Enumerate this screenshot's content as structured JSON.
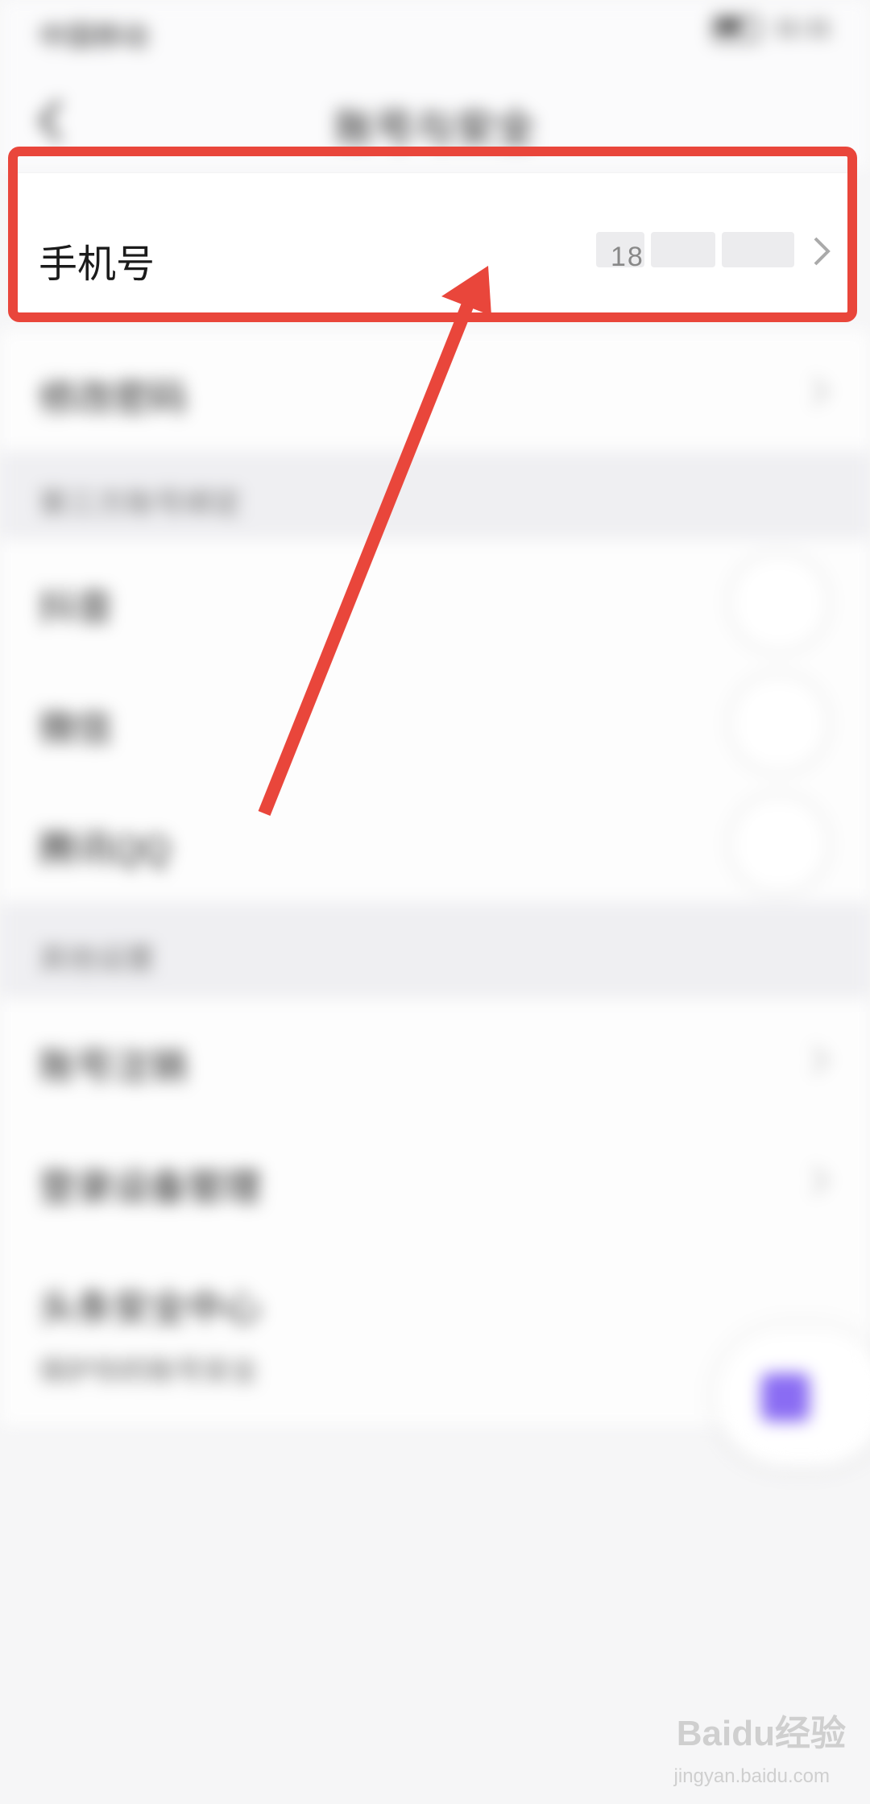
{
  "status_bar": {
    "left": "中国移动",
    "right": "11:11"
  },
  "nav": {
    "title": "账号与安全"
  },
  "phone_row": {
    "label": "手机号",
    "value_prefix": "18"
  },
  "rows_blurred": [
    {
      "label": "修改密码"
    }
  ],
  "section_bind": {
    "label": "第三方账号绑定"
  },
  "bind_items": [
    {
      "label": "抖音"
    },
    {
      "label": "微信"
    },
    {
      "label": "腾讯QQ"
    }
  ],
  "section_other": {
    "label": "其他设置"
  },
  "other_items": [
    {
      "label": "账号注销"
    },
    {
      "label": "登录设备管理"
    }
  ],
  "security_center": {
    "label": "头条安全中心",
    "subtitle": "保护你的账号安全"
  },
  "watermark": {
    "brand": "Baidu经验",
    "site": "jingyan.baidu.com"
  },
  "colors": {
    "highlight": "#e9463b",
    "fab_icon": "#8a6cf3"
  }
}
